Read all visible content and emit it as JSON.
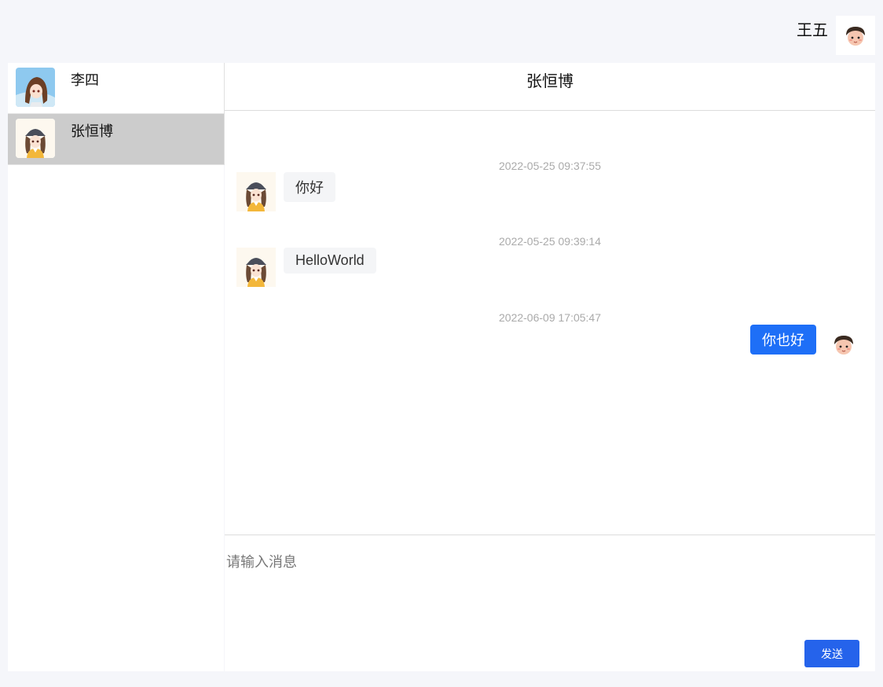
{
  "current_user": {
    "name": "王五",
    "avatar": "chibi-boy-avatar-icon"
  },
  "contacts": [
    {
      "name": "李四",
      "avatar": "anime-girl-blue-avatar-icon",
      "active": false
    },
    {
      "name": "张恒博",
      "avatar": "anime-girl-cap-avatar-icon",
      "active": true
    }
  ],
  "chat": {
    "title": "张恒博",
    "messages": [
      {
        "timestamp": "2022-05-25 09:37:55",
        "text": "你好",
        "side": "left"
      },
      {
        "timestamp": "2022-05-25 09:39:14",
        "text": "HelloWorld",
        "side": "left"
      },
      {
        "timestamp": "2022-06-09 17:05:47",
        "text": "你也好",
        "side": "right"
      }
    ]
  },
  "input": {
    "placeholder": "请输入消息",
    "value": "",
    "send_label": "发送"
  },
  "colors": {
    "accent": "#1e6ff7",
    "send_button": "#2563eb",
    "active_contact": "#cccccc",
    "page_bg": "#f5f6fa"
  }
}
